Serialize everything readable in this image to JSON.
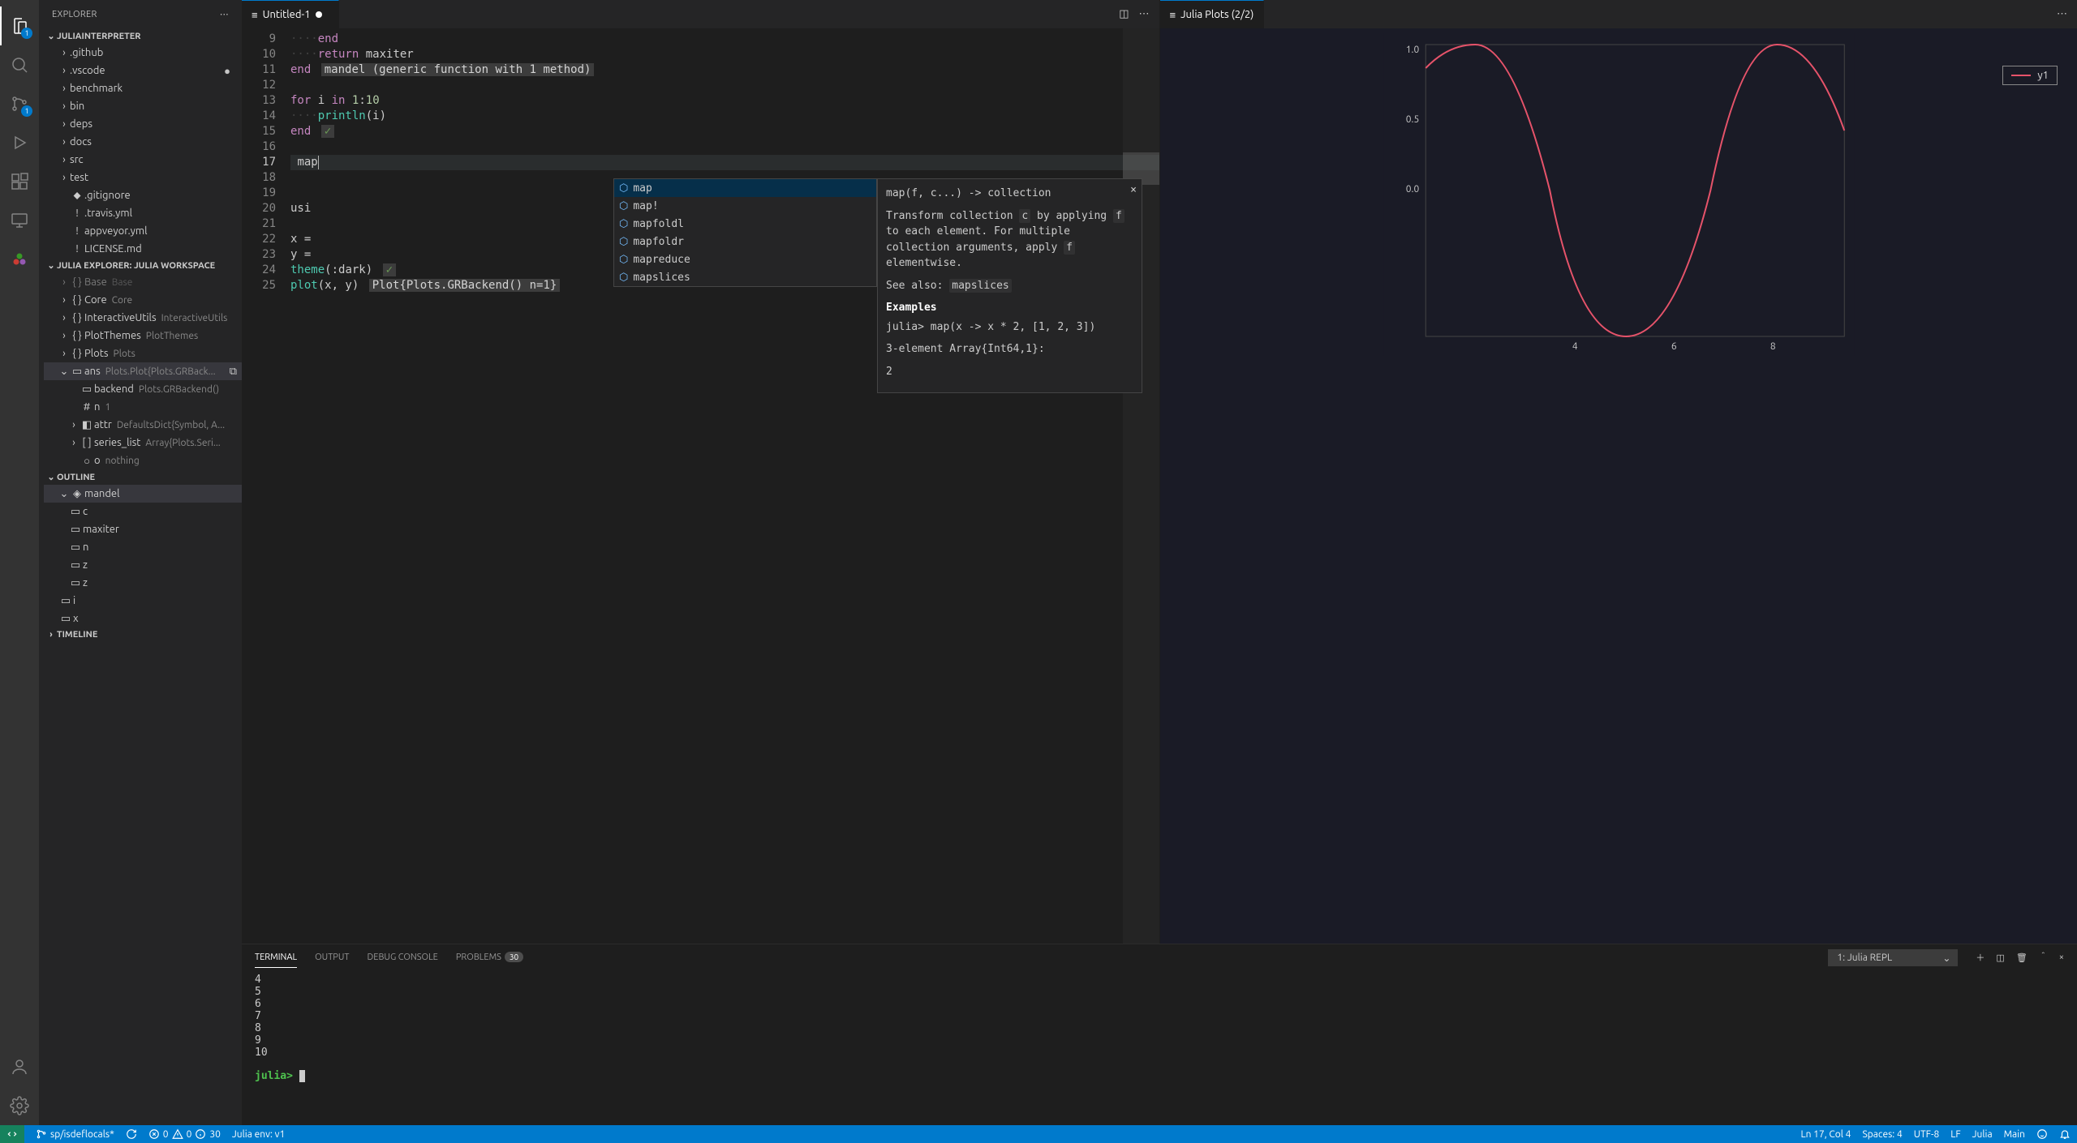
{
  "sidebar": {
    "title": "EXPLORER",
    "sections": {
      "project": "JULIAINTERPRETER",
      "workspace": "JULIA EXPLORER: JULIA WORKSPACE",
      "outline": "OUTLINE",
      "timeline": "TIMELINE"
    },
    "tree": [
      {
        "label": ".github",
        "kind": "folder"
      },
      {
        "label": ".vscode",
        "kind": "folder",
        "modified": true
      },
      {
        "label": "benchmark",
        "kind": "folder"
      },
      {
        "label": "bin",
        "kind": "folder"
      },
      {
        "label": "deps",
        "kind": "folder"
      },
      {
        "label": "docs",
        "kind": "folder"
      },
      {
        "label": "src",
        "kind": "folder"
      },
      {
        "label": "test",
        "kind": "folder"
      },
      {
        "label": ".gitignore",
        "kind": "file"
      },
      {
        "label": ".travis.yml",
        "kind": "file",
        "icon": "yellow"
      },
      {
        "label": "appveyor.yml",
        "kind": "file",
        "icon": "yellow"
      },
      {
        "label": "LICENSE.md",
        "kind": "file",
        "icon": "yellow"
      }
    ],
    "workspaceTree": [
      {
        "label": "Base",
        "dim": "Base"
      },
      {
        "label": "Core",
        "dim": "Core"
      },
      {
        "label": "InteractiveUtils",
        "dim": "InteractiveUtils"
      },
      {
        "label": "PlotThemes",
        "dim": "PlotThemes"
      },
      {
        "label": "Plots",
        "dim": "Plots"
      }
    ],
    "ans": {
      "label": "ans",
      "dim": "Plots.Plot{Plots.GRBack..."
    },
    "ansChildren": [
      {
        "label": "backend",
        "dim": "Plots.GRBackend()"
      },
      {
        "label": "n",
        "dim": "1"
      },
      {
        "label": "attr",
        "dim": "DefaultsDict{Symbol, A..."
      },
      {
        "label": "series_list",
        "dim": "Array{Plots.Seri..."
      },
      {
        "label": "o",
        "dim": "nothing"
      }
    ],
    "outlineItems": {
      "mandel": "mandel",
      "children": [
        "c",
        "maxiter",
        "n",
        "z",
        "z",
        "i",
        "x"
      ]
    }
  },
  "activityBadges": {
    "explorer": "1",
    "scm": "1"
  },
  "tabs": {
    "editor": "Untitled-1",
    "plot": "Julia Plots (2/2)"
  },
  "code": {
    "lines": {
      "9": "end",
      "10": "return maxiter",
      "11a": "end",
      "11b": "mandel (generic function with 1 method)",
      "13": "for i in 1:10",
      "14": "println(i)",
      "15": "end",
      "17": "map",
      "20": "usi",
      "22": "x =",
      "23": "y =",
      "24": "theme(:dark)",
      "25": "plot(x, y)",
      "25hint": "Plot{Plots.GRBackend() n=1}"
    }
  },
  "suggest": {
    "items": [
      "map",
      "map!",
      "mapfoldl",
      "mapfoldr",
      "mapreduce",
      "mapslices"
    ],
    "doc": {
      "sig": "map(f, c...) -> collection",
      "p1a": "Transform collection ",
      "p1b": " by applying ",
      "p1c": " to each element. For multiple collection arguments, apply ",
      "p1d": " elementwise.",
      "see": "See also: ",
      "seelink": "mapslices",
      "examplesHd": "Examples",
      "ex1": "julia> map(x -> x * 2, [1, 2, 3])",
      "ex2": "3-element Array{Int64,1}:",
      "ex3": " 2"
    }
  },
  "panel": {
    "tabs": {
      "terminal": "TERMINAL",
      "output": "OUTPUT",
      "debug": "DEBUG CONSOLE",
      "problems": "PROBLEMS"
    },
    "problemsCount": "30",
    "terminalName": "1: Julia REPL",
    "output": [
      "4",
      "5",
      "6",
      "7",
      "8",
      "9",
      "10"
    ],
    "prompt": "julia>"
  },
  "status": {
    "branch": "sp/isdeflocals*",
    "errors": "0",
    "warnings": "0",
    "info": "30",
    "env": "Julia env: v1",
    "ln": "Ln 17, Col 4",
    "spaces": "Spaces: 4",
    "enc": "UTF-8",
    "eol": "LF",
    "lang": "Julia",
    "main": "Main"
  },
  "chart_data": {
    "type": "line",
    "series": [
      {
        "name": "y1",
        "color": "#e6536a"
      }
    ],
    "xlim": [
      1,
      10
    ],
    "ylim": [
      -1,
      1
    ],
    "xticks": [
      4,
      6,
      8
    ],
    "yticks": [
      0.0,
      0.5,
      1.0
    ],
    "legend": "y1",
    "note": "sine-like curve: starts ~0.84 at x=1, peak 1.0 near x≈2, crosses 0 near x≈3.6, trough -1.0 near x≈5.1, crosses 0 near x≈6.7, peak 1.0 near x≈8.3, descending after"
  }
}
